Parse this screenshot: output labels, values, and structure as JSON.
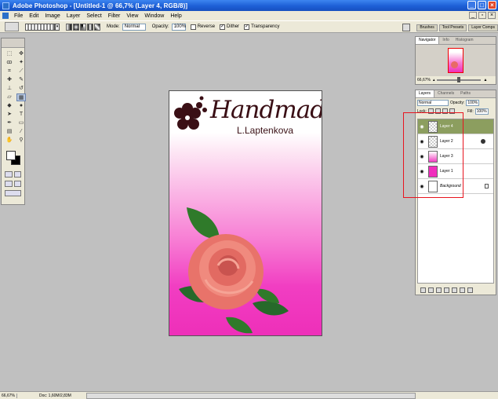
{
  "app": {
    "title": "Adobe Photoshop - [Untitled-1 @ 66,7% (Layer 4, RGB/8)]"
  },
  "menu": [
    "File",
    "Edit",
    "Image",
    "Layer",
    "Select",
    "Filter",
    "View",
    "Window",
    "Help"
  ],
  "options_bar": {
    "mode_label": "Mode:",
    "mode_value": "Normal",
    "opacity_label": "Opacity:",
    "opacity_value": "100%",
    "reverse_label": "Reverse",
    "reverse_checked": false,
    "dither_label": "Dither",
    "dither_checked": true,
    "transparency_label": "Transparency",
    "transparency_checked": true
  },
  "palette_well": {
    "tabs": [
      "Brushes",
      "Tool Presets",
      "Layer Comps"
    ]
  },
  "document": {
    "title": "Handmade",
    "subtitle": "L.Laptenkova"
  },
  "navigator": {
    "tabs": [
      "Navigator",
      "Info",
      "Histogram"
    ],
    "zoom": "66,67%"
  },
  "layers_panel": {
    "tabs": [
      "Layers",
      "Channels",
      "Paths"
    ],
    "blend_mode": "Normal",
    "opacity_label": "Opacity:",
    "opacity_value": "100%",
    "lock_label": "Lock:",
    "fill_label": "Fill:",
    "fill_value": "100%",
    "layers": [
      {
        "name": "Layer 4",
        "selected": true
      },
      {
        "name": "Layer 2",
        "selected": false
      },
      {
        "name": "Layer 3",
        "selected": false
      },
      {
        "name": "Layer 1",
        "selected": false
      },
      {
        "name": "Background",
        "selected": false
      }
    ]
  },
  "status": {
    "zoom": "66,67%",
    "doc": "Doc: 1,60M/2,83M"
  },
  "colors": {
    "title_bar": "#1d5fd6",
    "selected_layer": "#8c9e5f",
    "highlight": "#e8141f",
    "magenta": "#ee2fb9"
  }
}
